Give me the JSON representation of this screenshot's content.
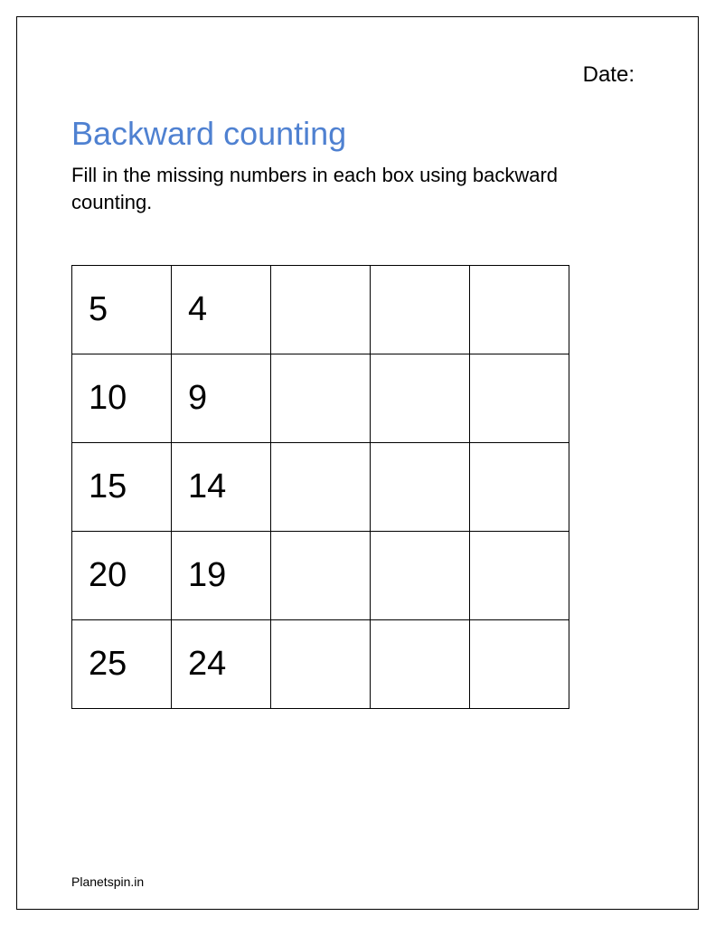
{
  "header": {
    "date_label": "Date:"
  },
  "title": "Backward counting",
  "instructions": "Fill in the missing numbers in each box using backward counting.",
  "grid": {
    "rows": [
      [
        "5",
        "4",
        "",
        "",
        ""
      ],
      [
        "10",
        "9",
        "",
        "",
        ""
      ],
      [
        "15",
        "14",
        "",
        "",
        ""
      ],
      [
        "20",
        "19",
        "",
        "",
        ""
      ],
      [
        "25",
        "24",
        "",
        "",
        ""
      ]
    ]
  },
  "footer": "Planetspin.in"
}
